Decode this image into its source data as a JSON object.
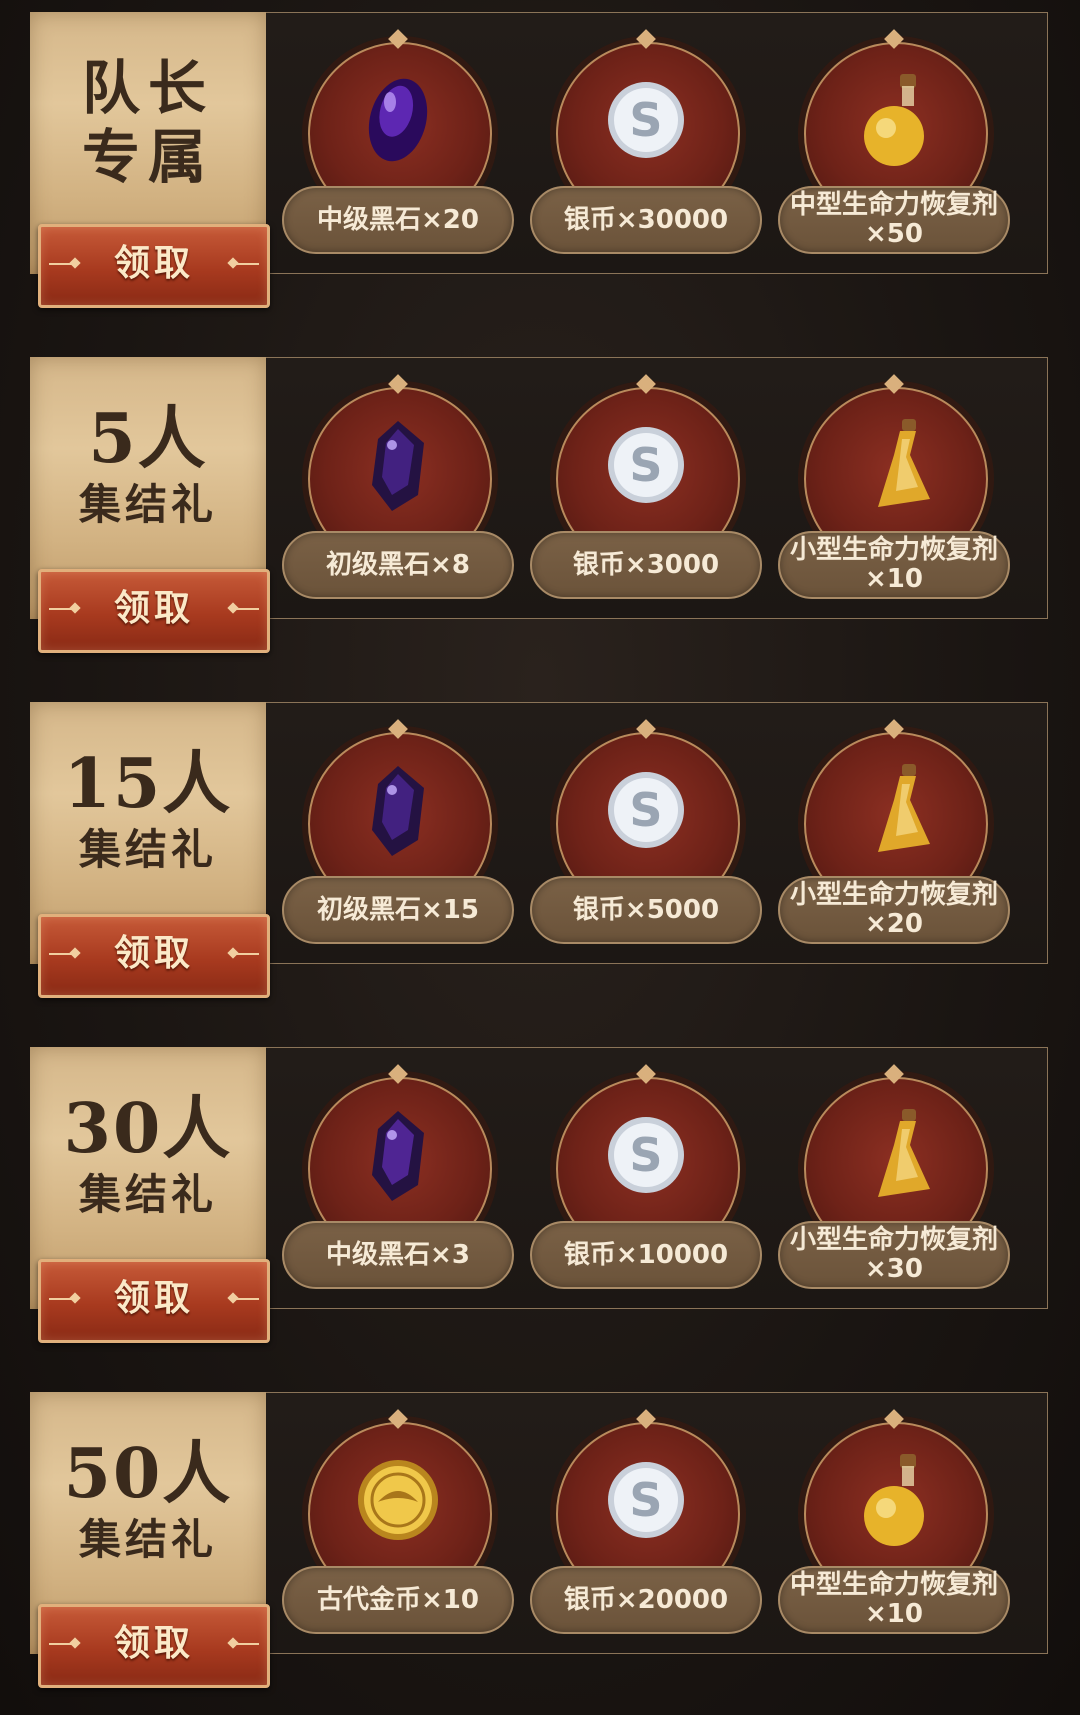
{
  "claim_label": "领取",
  "rows": [
    {
      "title_line1": "队长",
      "title_line2": "专属",
      "rewards": [
        {
          "icon": "black-stone-mid-icon",
          "name": "中级黑石×20"
        },
        {
          "icon": "silver-coin-icon",
          "name": "银币×30000"
        },
        {
          "icon": "hp-potion-mid-icon",
          "name": "中型生命力恢复剂×50"
        }
      ]
    },
    {
      "title_line1": "5人",
      "title_line2": "集结礼",
      "rewards": [
        {
          "icon": "black-stone-basic-icon",
          "name": "初级黑石×8"
        },
        {
          "icon": "silver-coin-icon",
          "name": "银币×3000"
        },
        {
          "icon": "hp-potion-small-icon",
          "name": "小型生命力恢复剂×10"
        }
      ]
    },
    {
      "title_line1": "15人",
      "title_line2": "集结礼",
      "rewards": [
        {
          "icon": "black-stone-basic-icon",
          "name": "初级黑石×15"
        },
        {
          "icon": "silver-coin-icon",
          "name": "银币×5000"
        },
        {
          "icon": "hp-potion-small-icon",
          "name": "小型生命力恢复剂×20"
        }
      ]
    },
    {
      "title_line1": "30人",
      "title_line2": "集结礼",
      "rewards": [
        {
          "icon": "black-stone-mid-icon",
          "name": "中级黑石×3"
        },
        {
          "icon": "silver-coin-icon",
          "name": "银币×10000"
        },
        {
          "icon": "hp-potion-small-icon",
          "name": "小型生命力恢复剂×30"
        }
      ]
    },
    {
      "title_line1": "50人",
      "title_line2": "集结礼",
      "rewards": [
        {
          "icon": "ancient-gold-coin-icon",
          "name": "古代金币×10"
        },
        {
          "icon": "silver-coin-icon",
          "name": "银币×20000"
        },
        {
          "icon": "hp-potion-mid-icon",
          "name": "中型生命力恢复剂×10"
        }
      ]
    }
  ]
}
